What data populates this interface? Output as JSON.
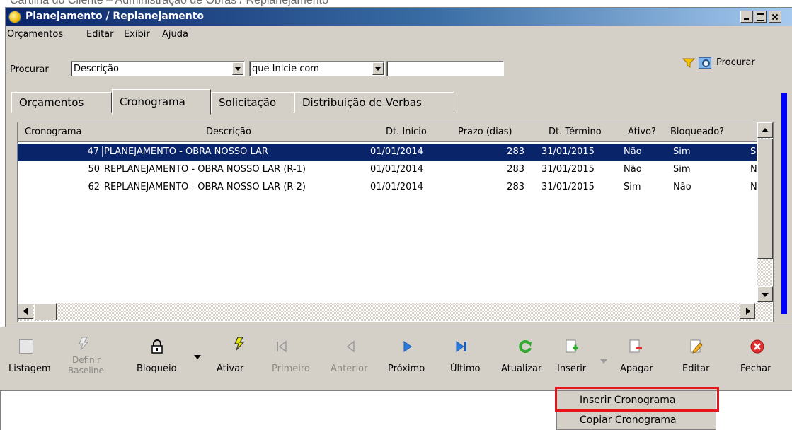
{
  "caption": "Cartilha do Cliente – Administração de Obras / Replanejamento",
  "window": {
    "title": "Planejamento / Replanejamento"
  },
  "menu": [
    "Orçamentos",
    "Editar",
    "Exibir",
    "Ajuda"
  ],
  "search": {
    "label": "Procurar",
    "field_value": "Descrição",
    "condition_value": "que Inicie com",
    "text_value": "",
    "button_label": "Procurar"
  },
  "tabs": [
    "Orçamentos",
    "Cronograma",
    "Solicitação",
    "Distribuição de Verbas"
  ],
  "active_tab": "Cronograma",
  "grid": {
    "columns": [
      "Cronograma",
      "Descrição",
      "Dt. Início",
      "Prazo (dias)",
      "Dt. Término",
      "Ativo?",
      "Bloqueado?"
    ],
    "rows": [
      {
        "cronograma": "47",
        "descricao": "PLANEJAMENTO - OBRA NOSSO LAR",
        "dt_inicio": "01/01/2014",
        "prazo": "283",
        "dt_termino": "31/01/2015",
        "ativo": "Não",
        "bloqueado": "Sim",
        "extra": "S"
      },
      {
        "cronograma": "50",
        "descricao": "REPLANEJAMENTO - OBRA NOSSO LAR (R-1)",
        "dt_inicio": "01/01/2014",
        "prazo": "283",
        "dt_termino": "31/01/2015",
        "ativo": "Não",
        "bloqueado": "Sim",
        "extra": "N"
      },
      {
        "cronograma": "62",
        "descricao": "REPLANEJAMENTO - OBRA NOSSO LAR (R-2)",
        "dt_inicio": "01/01/2014",
        "prazo": "283",
        "dt_termino": "31/01/2015",
        "ativo": "Sim",
        "bloqueado": "Não",
        "extra": "N"
      }
    ]
  },
  "toolbar": {
    "listagem": "Listagem",
    "definir_1": "Definir",
    "definir_2": "Baseline",
    "bloqueio": "Bloqueio",
    "ativar": "Ativar",
    "primeiro": "Primeiro",
    "anterior": "Anterior",
    "proximo": "Próximo",
    "ultimo": "Último",
    "atualizar": "Atualizar",
    "inserir": "Inserir",
    "apagar": "Apagar",
    "editar": "Editar",
    "fechar": "Fechar"
  },
  "dropdown": {
    "items": [
      "Inserir Cronograma",
      "Copiar Cronograma"
    ],
    "highlighted_item": "Inserir Cronograma",
    "highlight_color": "#e8141c"
  },
  "colors": {
    "title_bar": "#0a246a",
    "selection": "#0a246a",
    "face": "#d4d0c8",
    "accent_blue": "#0000ff"
  }
}
